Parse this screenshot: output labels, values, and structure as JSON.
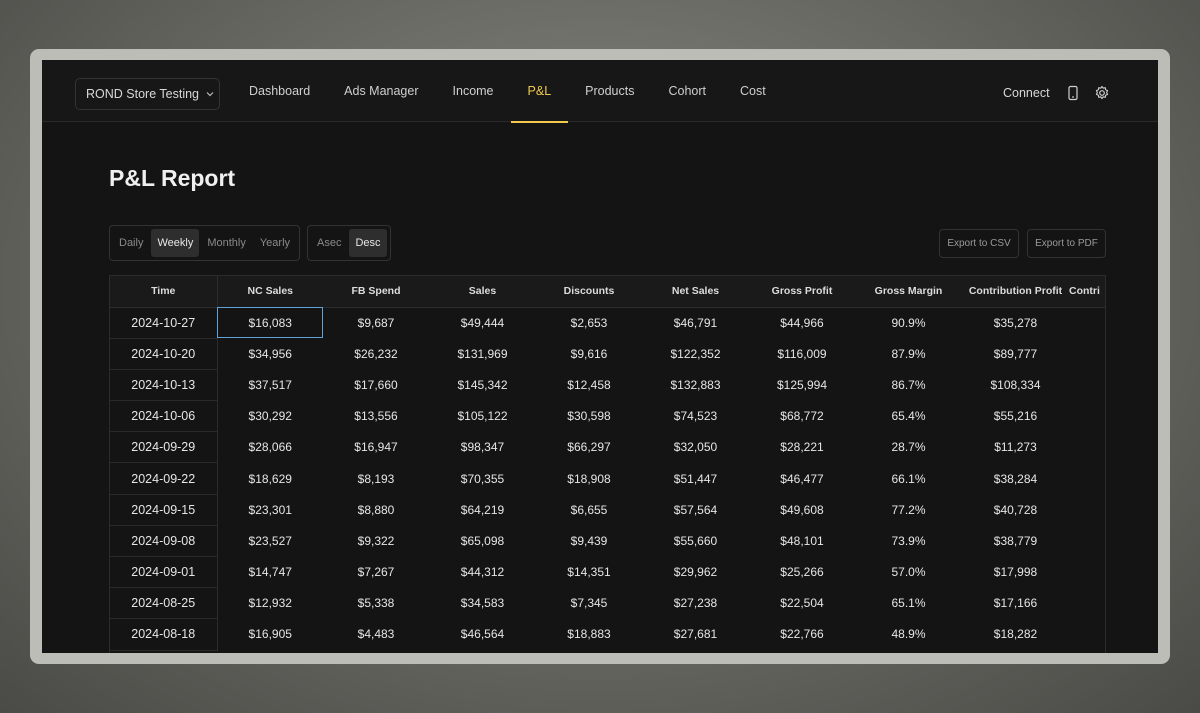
{
  "header": {
    "store": "ROND Store Testing",
    "nav": [
      "Dashboard",
      "Ads Manager",
      "Income",
      "P&L",
      "Products",
      "Cohort",
      "Cost"
    ],
    "active_nav": "P&L",
    "connect": "Connect",
    "icons": [
      "phone-icon",
      "gear-icon"
    ],
    "accent_color": "#f2c94c"
  },
  "page": {
    "title": "P&L Report"
  },
  "filters": {
    "period": [
      "Daily",
      "Weekly",
      "Monthly",
      "Yearly"
    ],
    "period_selected": "Weekly",
    "sort": [
      "Asec",
      "Desc"
    ],
    "sort_selected": "Desc"
  },
  "exports": {
    "csv": "Export to CSV",
    "pdf": "Export to PDF"
  },
  "table": {
    "columns": [
      "Time",
      "NC Sales",
      "FB Spend",
      "Sales",
      "Discounts",
      "Net Sales",
      "Gross Profit",
      "Gross Margin",
      "Contribution Profit",
      "Contri"
    ],
    "rows": [
      [
        "2024-10-27",
        "$16,083",
        "$9,687",
        "$49,444",
        "$2,653",
        "$46,791",
        "$44,966",
        "90.9%",
        "$35,278"
      ],
      [
        "2024-10-20",
        "$34,956",
        "$26,232",
        "$131,969",
        "$9,616",
        "$122,352",
        "$116,009",
        "87.9%",
        "$89,777"
      ],
      [
        "2024-10-13",
        "$37,517",
        "$17,660",
        "$145,342",
        "$12,458",
        "$132,883",
        "$125,994",
        "86.7%",
        "$108,334"
      ],
      [
        "2024-10-06",
        "$30,292",
        "$13,556",
        "$105,122",
        "$30,598",
        "$74,523",
        "$68,772",
        "65.4%",
        "$55,216"
      ],
      [
        "2024-09-29",
        "$28,066",
        "$16,947",
        "$98,347",
        "$66,297",
        "$32,050",
        "$28,221",
        "28.7%",
        "$11,273"
      ],
      [
        "2024-09-22",
        "$18,629",
        "$8,193",
        "$70,355",
        "$18,908",
        "$51,447",
        "$46,477",
        "66.1%",
        "$38,284"
      ],
      [
        "2024-09-15",
        "$23,301",
        "$8,880",
        "$64,219",
        "$6,655",
        "$57,564",
        "$49,608",
        "77.2%",
        "$40,728"
      ],
      [
        "2024-09-08",
        "$23,527",
        "$9,322",
        "$65,098",
        "$9,439",
        "$55,660",
        "$48,101",
        "73.9%",
        "$38,779"
      ],
      [
        "2024-09-01",
        "$14,747",
        "$7,267",
        "$44,312",
        "$14,351",
        "$29,962",
        "$25,266",
        "57.0%",
        "$17,998"
      ],
      [
        "2024-08-25",
        "$12,932",
        "$5,338",
        "$34,583",
        "$7,345",
        "$27,238",
        "$22,504",
        "65.1%",
        "$17,166"
      ],
      [
        "2024-08-18",
        "$16,905",
        "$4,483",
        "$46,564",
        "$18,883",
        "$27,681",
        "$22,766",
        "48.9%",
        "$18,282"
      ]
    ],
    "selected_cell": {
      "row": 0,
      "col": 1
    },
    "selection_color": "#5fa3d9"
  }
}
